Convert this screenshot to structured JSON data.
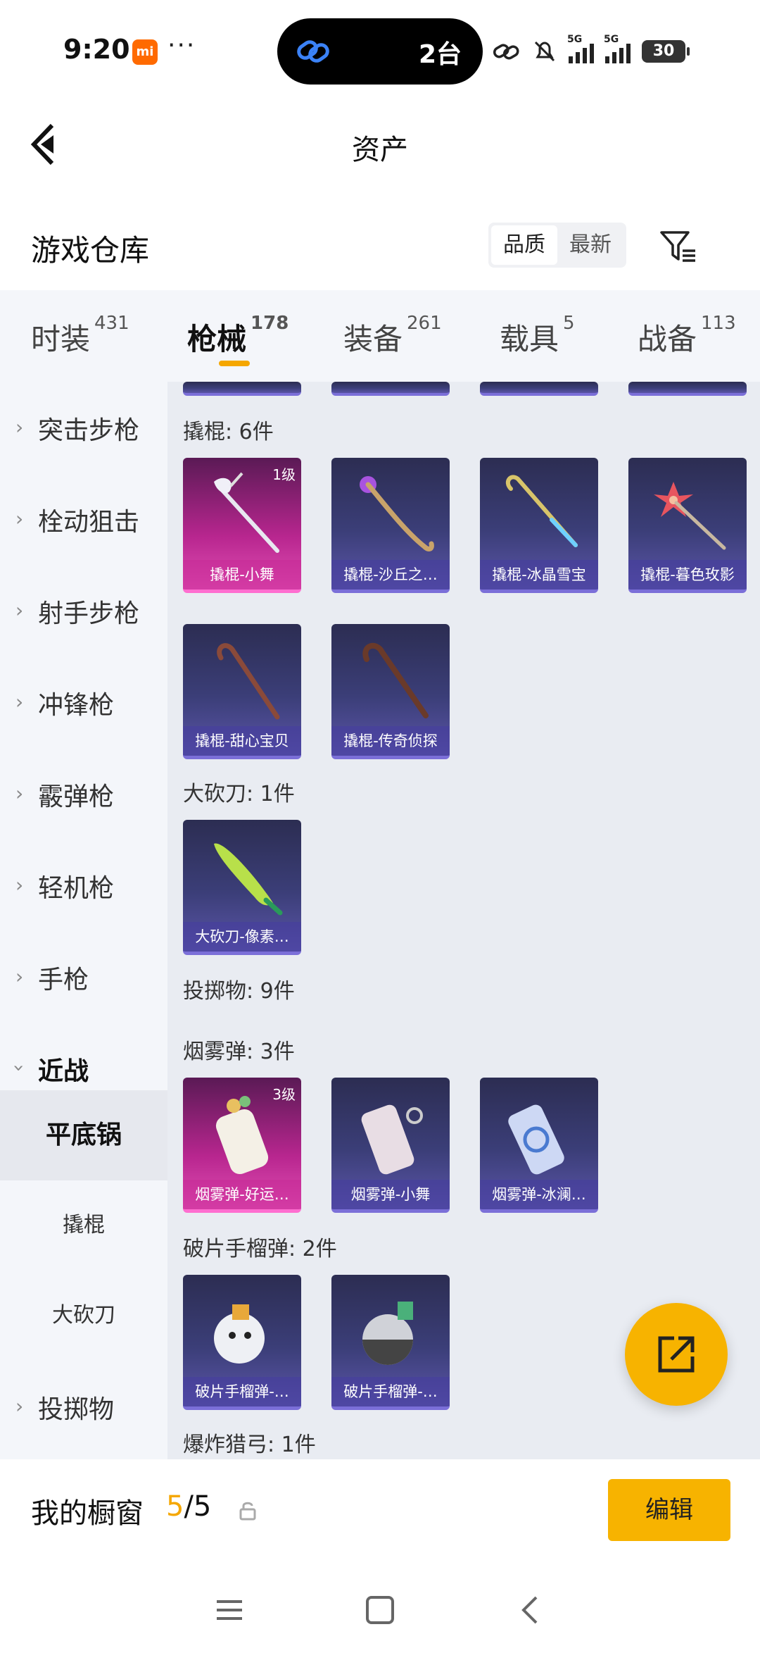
{
  "status": {
    "time": "9:20",
    "island_text": "2台",
    "battery": "30"
  },
  "header": {
    "title": "资产"
  },
  "section": {
    "title": "游戏仓库",
    "sort_options": [
      "品质",
      "最新"
    ]
  },
  "tabs": [
    {
      "label": "时装",
      "count": "431"
    },
    {
      "label": "枪械",
      "count": "178"
    },
    {
      "label": "装备",
      "count": "261"
    },
    {
      "label": "载具",
      "count": "5"
    },
    {
      "label": "战备",
      "count": "113"
    }
  ],
  "sidebar": {
    "items": [
      "突击步枪",
      "栓动狙击",
      "射手步枪",
      "冲锋枪",
      "霰弹枪",
      "轻机枪",
      "手枪",
      "近战"
    ],
    "sub_items": [
      "平底锅",
      "撬棍",
      "大砍刀"
    ],
    "after": "投掷物"
  },
  "groups": {
    "crowbar": {
      "label": "撬棍: 6件",
      "cards": [
        {
          "name": "撬棍-小舞",
          "level": "1级"
        },
        {
          "name": "撬棍-沙丘之…"
        },
        {
          "name": "撬棍-冰晶雪宝"
        },
        {
          "name": "撬棍-暮色玫影"
        },
        {
          "name": "撬棍-甜心宝贝"
        },
        {
          "name": "撬棍-传奇侦探"
        }
      ]
    },
    "machete": {
      "label": "大砍刀: 1件",
      "cards": [
        {
          "name": "大砍刀-像素…"
        }
      ]
    },
    "throwables": {
      "label": "投掷物: 9件"
    },
    "smoke": {
      "label": "烟雾弹: 3件",
      "cards": [
        {
          "name": "烟雾弹-好运…",
          "level": "3级"
        },
        {
          "name": "烟雾弹-小舞"
        },
        {
          "name": "烟雾弹-冰澜…"
        }
      ]
    },
    "frag": {
      "label": "破片手榴弹: 2件",
      "cards": [
        {
          "name": "破片手榴弹-…"
        },
        {
          "name": "破片手榴弹-…"
        }
      ]
    },
    "bow": {
      "label": "爆炸猎弓: 1件"
    }
  },
  "bottom": {
    "label": "我的橱窗",
    "count_current": "5",
    "count_total": "/5",
    "edit": "编辑"
  }
}
